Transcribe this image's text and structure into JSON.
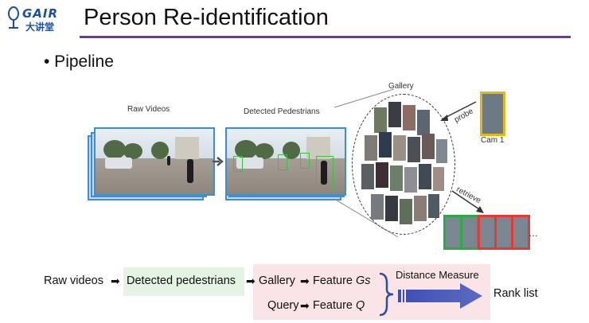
{
  "header": {
    "logo_text_top": "GAIR",
    "logo_text_bottom": "大讲堂",
    "title": "Person Re-identification"
  },
  "bullet": "• Pipeline",
  "diagram": {
    "raw_videos_label": "Raw Videos",
    "detected_pedestrians_label": "Detected Pedestrians",
    "gallery_label": "Gallery",
    "probe_label": "probe",
    "cam_label": "Cam 1",
    "retrieve_label": "retrieve",
    "ellipsis": "…"
  },
  "pipeline": {
    "raw_videos": "Raw videos",
    "detected_pedestrians": "Detected pedestrians",
    "gallery": "Gallery",
    "feature_g": "Feature ",
    "feature_g_var": "Gs",
    "query": "Query",
    "feature_q": "Feature ",
    "feature_q_var": "Q",
    "distance_measure": "Distance Measure",
    "rank_list": "Rank list"
  },
  "colors": {
    "title_rule": "#6a3d9a",
    "panel_border": "#3d8fd0",
    "probe_border": "#e3b714",
    "rank_green": "#2fa84a",
    "rank_red": "#e53935",
    "distance_arrow": "#3f51b5"
  }
}
